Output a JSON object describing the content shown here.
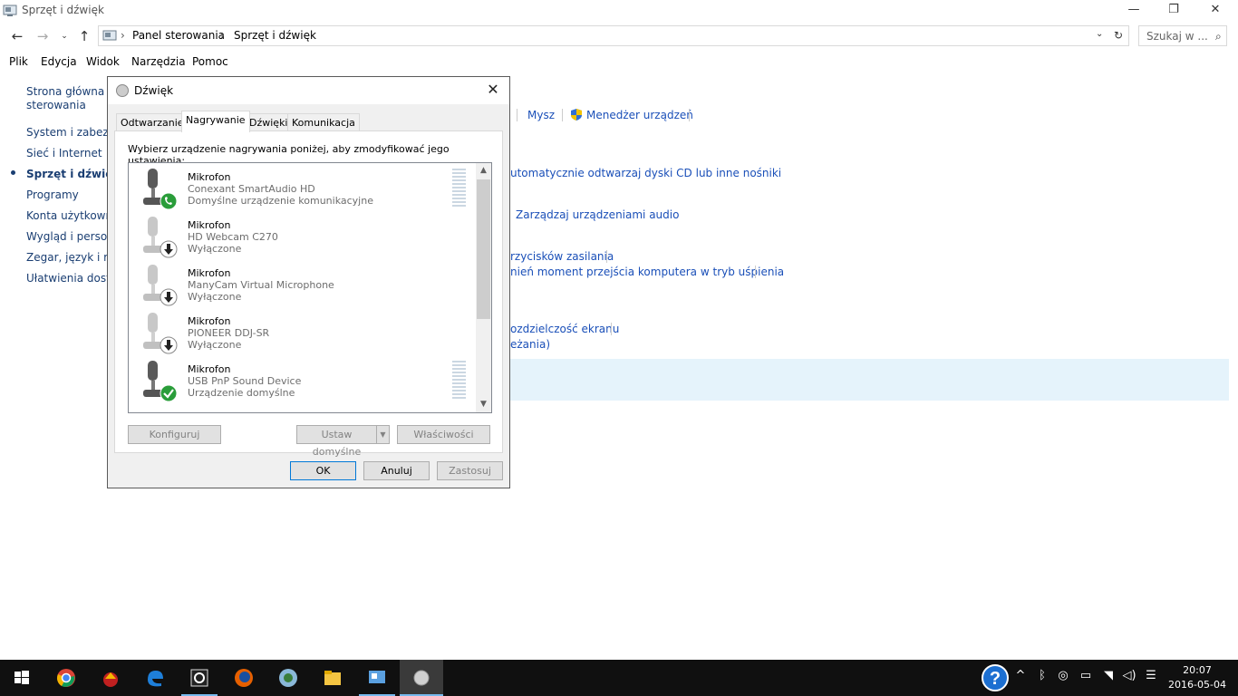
{
  "window": {
    "title": "Sprzęt i dźwięk",
    "minimize": "—",
    "restore": "❐",
    "close": "✕"
  },
  "address": {
    "crumbs": [
      "Panel sterowania",
      "Sprzęt i dźwięk"
    ],
    "search_placeholder": "Szukaj w ..."
  },
  "menu": [
    "Plik",
    "Edycja",
    "Widok",
    "Narzędzia",
    "Pomoc"
  ],
  "sidebar": {
    "items": [
      "Strona główna Pa",
      "sterowania",
      "System i zabezpie",
      "Sieć i Internet",
      "Sprzęt i dźwięk",
      "Programy",
      "Konta użytkowni",
      "Wygląd i persona",
      "Zegar, język i reg",
      "Ułatwienia dostęp"
    ]
  },
  "content": {
    "links": [
      "Mysz",
      "Menedżer urządzeń",
      "utomatycznie odtwarzaj dyski CD lub inne nośniki",
      "Zarządzaj urządzeniami audio",
      "rzycisków zasilania",
      "nień moment przejścia komputera w tryb uśpienia",
      "ozdzielczość ekranu",
      "eżania)"
    ]
  },
  "dialog": {
    "title": "Dźwięk",
    "close": "✕",
    "tabs": [
      "Odtwarzanie",
      "Nagrywanie",
      "Dźwięki",
      "Komunikacja"
    ],
    "active_tab": "Nagrywanie",
    "instruction": "Wybierz urządzenie nagrywania poniżej, aby zmodyfikować jego ustawienia:",
    "devices": [
      {
        "name": "Mikrofon",
        "device": "Conexant SmartAudio HD",
        "status": "Domyślne urządzenie komunikacyjne",
        "badge": "phone",
        "enabled": true
      },
      {
        "name": "Mikrofon",
        "device": "HD Webcam C270",
        "status": "Wyłączone",
        "badge": "down-arrow",
        "enabled": false
      },
      {
        "name": "Mikrofon",
        "device": "ManyCam Virtual Microphone",
        "status": "Wyłączone",
        "badge": "down-arrow",
        "enabled": false
      },
      {
        "name": "Mikrofon",
        "device": "PIONEER DDJ-SR",
        "status": "Wyłączone",
        "badge": "down-arrow",
        "enabled": false
      },
      {
        "name": "Mikrofon",
        "device": "USB PnP Sound Device",
        "status": "Urządzenie domyślne",
        "badge": "check",
        "enabled": true
      }
    ],
    "buttons": {
      "configure": "Konfiguruj",
      "set_default": "Ustaw domyślne",
      "properties": "Właściwości",
      "ok": "OK",
      "cancel": "Anuluj",
      "apply": "Zastosuj"
    }
  },
  "taskbar": {
    "apps": [
      "start-icon",
      "chrome-icon",
      "app-icon",
      "edge-icon",
      "app2-icon",
      "firefox-icon",
      "app3-icon",
      "file-explorer-icon",
      "control-panel-icon",
      "sound-icon"
    ],
    "time": "20:07",
    "date": "2016-05-04"
  }
}
